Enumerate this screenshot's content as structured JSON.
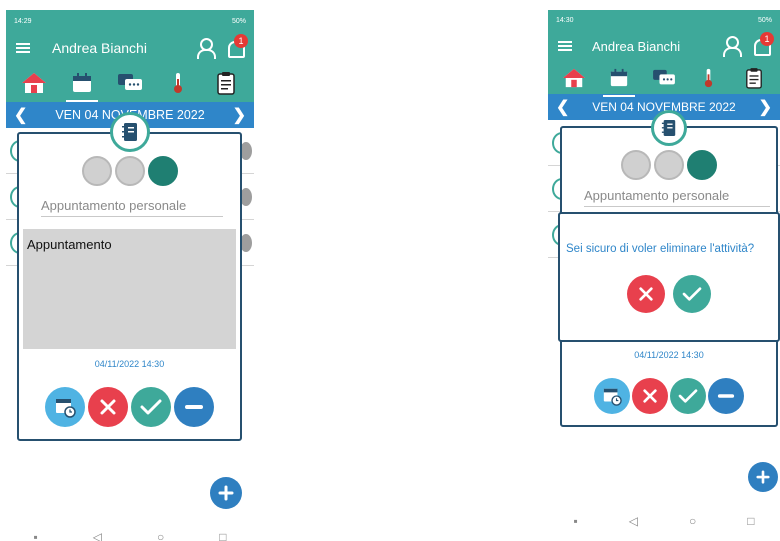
{
  "status_left": {
    "time": "14:29"
  },
  "status_right": {
    "time": "14:30"
  },
  "status_battery": "50%",
  "app": {
    "user_name": "Andrea Bianchi",
    "notification_count": "1"
  },
  "date_bar": {
    "date": "VEN 04 NOVEMBRE 2022"
  },
  "card": {
    "title_placeholder": "Appuntamento personale",
    "description": "Appuntamento",
    "datetime": "04/11/2022 14:30",
    "selected_mood": "happy"
  },
  "dialog": {
    "message": "Sei sicuro di voler eliminare l'attività?"
  },
  "icons": {
    "tabs": [
      "home-icon",
      "calendar-icon",
      "chat-icon",
      "thermometer-icon",
      "clipboard-icon"
    ],
    "actions": [
      "calendar-clock-icon",
      "close-icon",
      "check-icon",
      "minus-icon"
    ],
    "fab": "plus-icon"
  },
  "colors": {
    "primary": "#3ea99a",
    "date_bar": "#2f86c9",
    "cancel": "#e8404d",
    "card_border": "#26506f"
  }
}
